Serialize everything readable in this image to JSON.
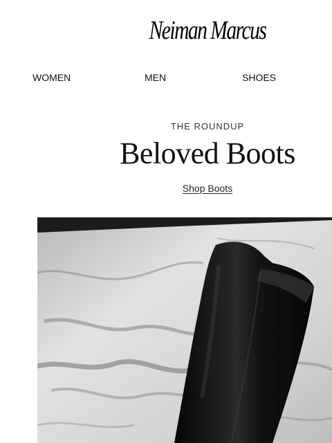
{
  "brand": {
    "logo_text": "Neiman Marcus"
  },
  "nav": {
    "items": [
      {
        "label": "WOMEN"
      },
      {
        "label": "MEN"
      },
      {
        "label": "SHOES"
      }
    ]
  },
  "feature": {
    "eyebrow": "THE ROUNDUP",
    "headline": "Beloved Boots",
    "cta_label": "Shop Boots"
  },
  "hero": {
    "image_subject": "black leather knee-high boot on marble surface",
    "colors": {
      "marble_light": "#dcdcda",
      "marble_vein": "#7d7d7b",
      "boot": "#111111",
      "backdrop": "#1a1a1a"
    }
  }
}
